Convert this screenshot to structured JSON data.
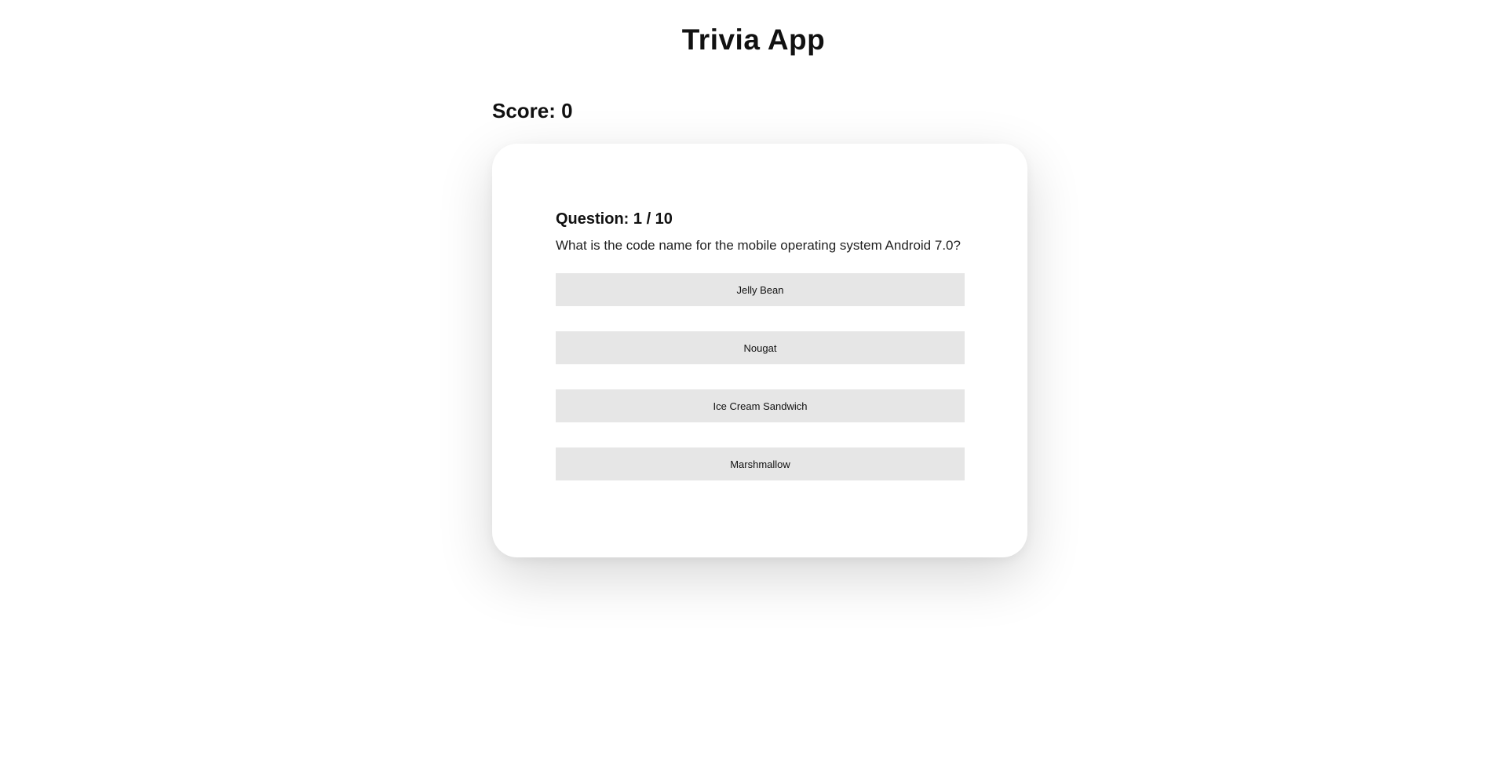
{
  "header": {
    "title": "Trivia App"
  },
  "score": {
    "text": "Score: 0"
  },
  "question": {
    "header": "Question: 1 / 10",
    "text": "What is the code name for the mobile operating system Android 7.0?"
  },
  "answers": [
    {
      "label": "Jelly Bean"
    },
    {
      "label": "Nougat"
    },
    {
      "label": "Ice Cream Sandwich"
    },
    {
      "label": "Marshmallow"
    }
  ]
}
